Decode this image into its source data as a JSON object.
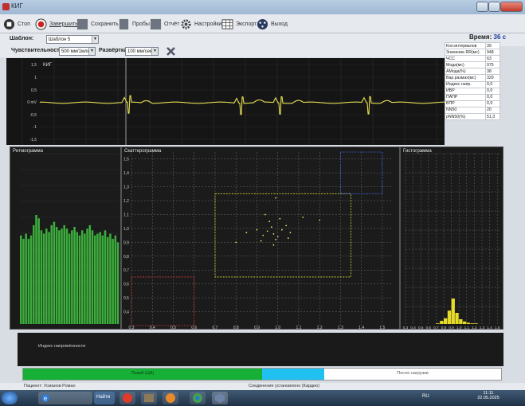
{
  "window": {
    "title": "КИГ"
  },
  "toolbar": {
    "stop": "Стоп",
    "finish": "Завершить",
    "save": "Сохранить",
    "samples": "Пробы",
    "report": "Отчёт",
    "settings": "Настройки",
    "export": "Экспорт",
    "exit": "Выход"
  },
  "template": {
    "label": "Шаблон:",
    "value": "Шаблон 5"
  },
  "sensitivity": {
    "label": "Чувствительность",
    "value": "500 мм/1млн"
  },
  "sweep": {
    "label": "Развёртка",
    "value": "100 мм/сек"
  },
  "time": {
    "label": "Время:",
    "value": "36",
    "unit": "с"
  },
  "ecg": {
    "label": "КИГ",
    "ticks": [
      "1,5",
      "1",
      "0,5",
      "0 mV",
      "-0,5",
      "-1",
      "-1,5"
    ],
    "trace_color": "#e4df50"
  },
  "params": [
    {
      "name": "Кол.интервалов",
      "value": "39"
    },
    {
      "name": "Значение RR(мс)",
      "value": "948"
    },
    {
      "name": "ЧСС",
      "value": "63"
    },
    {
      "name": "Мода(мс)",
      "value": "975"
    },
    {
      "name": "АМода(%)",
      "value": "38"
    },
    {
      "name": "Вар.размах(мс)",
      "value": "329"
    },
    {
      "name": "Индекс напр.",
      "value": "0,0"
    },
    {
      "name": "ИВР",
      "value": "0,0"
    },
    {
      "name": "ПАПР",
      "value": "0,0"
    },
    {
      "name": "ВПР",
      "value": "0,0"
    },
    {
      "name": "NN50",
      "value": "20"
    },
    {
      "name": "pNN50(%)",
      "value": "51,3"
    }
  ],
  "panels": {
    "rhythmogram": "Ритмограмма",
    "scatter": "Скаттерограмма",
    "histogram": "Гистограмма"
  },
  "scatter_axis": {
    "y": [
      "1,5",
      "1,4",
      "1,3",
      "1,2",
      "1,1",
      "1,0",
      "0,9",
      "0,8",
      "0,7",
      "0,6",
      "0,5",
      "0,4"
    ],
    "x": [
      "0,3",
      "0,4",
      "0,5",
      "0,6",
      "0,7",
      "0,8",
      "0,9",
      "1,0",
      "1,1",
      "1,2",
      "1,3",
      "1,4",
      "1,5"
    ]
  },
  "hist_axis": [
    "0,3",
    "0,4",
    "0,5",
    "0,6",
    "0,7",
    "0,8",
    "0,9",
    "1,0",
    "1,1",
    "1,2",
    "1,3",
    "1,4",
    "1,5"
  ],
  "stress_index_label": "Индекс напряжённости",
  "phases": {
    "rest": "Покой (ЦА)",
    "after": "После нагрузки"
  },
  "footer": {
    "patient": "Пациент: Усманов Роман",
    "connection": "Соединение установлено (Кардио)"
  },
  "taskbar": {
    "lang": "RU",
    "time": "11:11",
    "date": "22.05.2025",
    "app_label": "Найти"
  },
  "chart_data": [
    {
      "type": "bar",
      "name": "rhythmogram",
      "title": "Ритмограмма",
      "values": [
        0.52,
        0.5,
        0.53,
        0.5,
        0.52,
        0.58,
        0.64,
        0.62,
        0.55,
        0.53,
        0.56,
        0.54,
        0.58,
        0.6,
        0.57,
        0.55,
        0.56,
        0.58,
        0.56,
        0.53,
        0.55,
        0.57,
        0.54,
        0.52,
        0.55,
        0.53,
        0.56,
        0.58,
        0.55,
        0.52,
        0.53,
        0.54,
        0.52,
        0.55,
        0.51,
        0.53,
        0.5,
        0.52,
        0.48
      ],
      "color": "#3cae3c"
    },
    {
      "type": "scatter",
      "name": "scatterogram",
      "title": "Скаттерограмма",
      "xlim": [
        0.3,
        1.55
      ],
      "ylim": [
        0.3,
        1.55
      ],
      "points": [
        [
          0.98,
          0.96
        ],
        [
          1.02,
          0.99
        ],
        [
          0.97,
          1.01
        ],
        [
          1.0,
          0.94
        ],
        [
          0.95,
          0.98
        ],
        [
          1.04,
          1.02
        ],
        [
          0.99,
          0.92
        ],
        [
          0.93,
          0.95
        ],
        [
          1.06,
          0.97
        ],
        [
          0.96,
          1.05
        ],
        [
          1.01,
          1.07
        ],
        [
          0.92,
          0.91
        ],
        [
          0.85,
          0.97
        ],
        [
          1.12,
          1.08
        ],
        [
          0.98,
          0.88
        ],
        [
          0.94,
          1.1
        ],
        [
          1.05,
          0.93
        ],
        [
          0.9,
          0.99
        ],
        [
          1.2,
          1.06
        ],
        [
          0.8,
          0.9
        ],
        [
          0.99,
          1.22
        ]
      ],
      "boxes": [
        {
          "x": [
            0.7,
            1.35
          ],
          "y": [
            0.65,
            1.25
          ],
          "color": "#d8d83c"
        },
        {
          "x": [
            1.3,
            1.5
          ],
          "y": [
            1.25,
            1.55
          ],
          "color": "#3c64e6"
        },
        {
          "x": [
            0.3,
            0.6
          ],
          "y": [
            0.3,
            0.65
          ],
          "color": "#c83c3c"
        }
      ]
    },
    {
      "type": "bar",
      "name": "histogram",
      "title": "Гистограмма",
      "categories": [
        "0,7",
        "0,75",
        "0,8",
        "0,85",
        "0,9",
        "0,95",
        "1,0",
        "1,05",
        "1,1",
        "1,15",
        "1,2"
      ],
      "values": [
        0.02,
        0.1,
        0.18,
        0.42,
        0.8,
        0.35,
        0.15,
        0.08,
        0.04,
        0.02,
        0.02
      ],
      "xlim": [
        0.3,
        1.55
      ],
      "color": "#e6dc28"
    }
  ]
}
